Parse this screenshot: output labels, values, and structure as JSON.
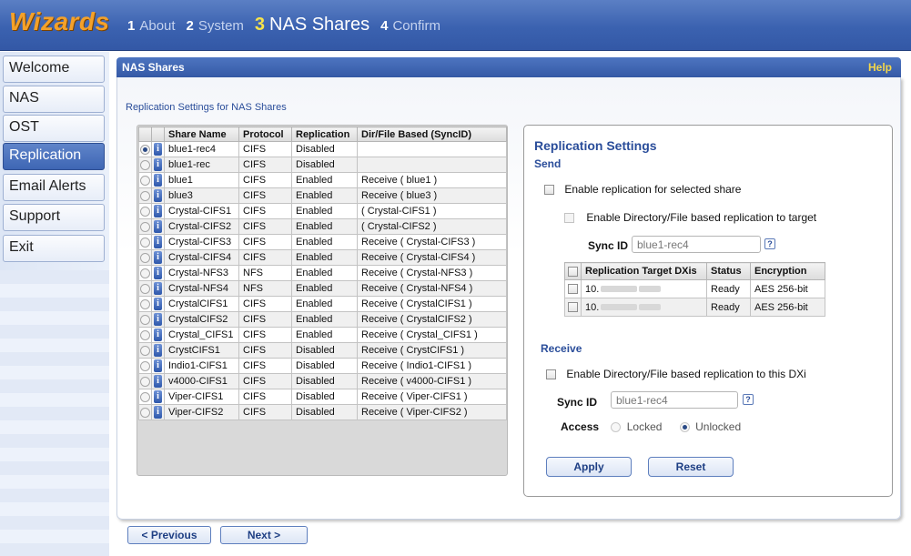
{
  "app": {
    "title": "Wizards"
  },
  "steps": [
    {
      "num": "1",
      "label": "About",
      "active": false
    },
    {
      "num": "2",
      "label": "System",
      "active": false
    },
    {
      "num": "3",
      "label": "NAS Shares",
      "active": true
    },
    {
      "num": "4",
      "label": "Confirm",
      "active": false
    }
  ],
  "nav": [
    {
      "label": "Welcome",
      "active": false
    },
    {
      "label": "NAS",
      "active": false
    },
    {
      "label": "OST",
      "active": false
    },
    {
      "label": "Replication",
      "active": true
    },
    {
      "label": "Email Alerts",
      "active": false
    },
    {
      "label": "Support",
      "active": false
    },
    {
      "label": "Exit",
      "active": false
    }
  ],
  "panel": {
    "title": "NAS Shares",
    "help": "Help",
    "section_title": "Replication Settings for NAS Shares"
  },
  "shares": {
    "columns": [
      "Share Name",
      "Protocol",
      "Replication",
      "Dir/File Based (SyncID)"
    ],
    "selected_index": 0,
    "rows": [
      [
        "blue1-rec4",
        "CIFS",
        "Disabled",
        ""
      ],
      [
        "blue1-rec",
        "CIFS",
        "Disabled",
        ""
      ],
      [
        "blue1",
        "CIFS",
        "Enabled",
        "Receive ( blue1 )"
      ],
      [
        "blue3",
        "CIFS",
        "Enabled",
        "Receive ( blue3 )"
      ],
      [
        "Crystal-CIFS1",
        "CIFS",
        "Enabled",
        "( Crystal-CIFS1 )"
      ],
      [
        "Crystal-CIFS2",
        "CIFS",
        "Enabled",
        "( Crystal-CIFS2 )"
      ],
      [
        "Crystal-CIFS3",
        "CIFS",
        "Enabled",
        "Receive ( Crystal-CIFS3 )"
      ],
      [
        "Crystal-CIFS4",
        "CIFS",
        "Enabled",
        "Receive ( Crystal-CIFS4 )"
      ],
      [
        "Crystal-NFS3",
        "NFS",
        "Enabled",
        "Receive ( Crystal-NFS3 )"
      ],
      [
        "Crystal-NFS4",
        "NFS",
        "Enabled",
        "Receive ( Crystal-NFS4 )"
      ],
      [
        "CrystalCIFS1",
        "CIFS",
        "Enabled",
        "Receive ( CrystalCIFS1 )"
      ],
      [
        "CrystalCIFS2",
        "CIFS",
        "Enabled",
        "Receive ( CrystalCIFS2 )"
      ],
      [
        "Crystal_CIFS1",
        "CIFS",
        "Enabled",
        "Receive ( Crystal_CIFS1 )"
      ],
      [
        "CrystCIFS1",
        "CIFS",
        "Disabled",
        "Receive ( CrystCIFS1 )"
      ],
      [
        "Indio1-CIFS1",
        "CIFS",
        "Disabled",
        "Receive ( Indio1-CIFS1 )"
      ],
      [
        "v4000-CIFS1",
        "CIFS",
        "Disabled",
        "Receive ( v4000-CIFS1 )"
      ],
      [
        "Viper-CIFS1",
        "CIFS",
        "Disabled",
        "Receive ( Viper-CIFS1 )"
      ],
      [
        "Viper-CIFS2",
        "CIFS",
        "Disabled",
        "Receive ( Viper-CIFS2 )"
      ]
    ]
  },
  "replication": {
    "title": "Replication Settings",
    "send": {
      "heading": "Send",
      "enable_label": "Enable replication for selected share",
      "dirfile_label": "Enable Directory/File based replication to target",
      "sync_id_label": "Sync ID",
      "sync_id_value": "blue1-rec4",
      "help_icon": "?"
    },
    "targets": {
      "columns": [
        "Replication Target DXis",
        "Status",
        "Encryption"
      ],
      "rows": [
        {
          "target": "10.",
          "status": "Ready",
          "encryption": "AES 256-bit"
        },
        {
          "target": "10.",
          "status": "Ready",
          "encryption": "AES 256-bit"
        }
      ]
    },
    "receive": {
      "heading": "Receive",
      "enable_label": "Enable Directory/File based replication to this DXi",
      "sync_id_label": "Sync ID",
      "sync_id_value": "blue1-rec4",
      "help_icon": "?",
      "access_label": "Access",
      "access_options": [
        "Locked",
        "Unlocked"
      ],
      "access_selected": "Unlocked"
    },
    "apply": "Apply",
    "reset": "Reset"
  },
  "footer": {
    "previous": "< Previous",
    "next": "Next >"
  },
  "colors": {
    "banner": "#3b62b0",
    "accent_orange": "#f4a12a",
    "heading_blue": "#2a4d9a"
  }
}
